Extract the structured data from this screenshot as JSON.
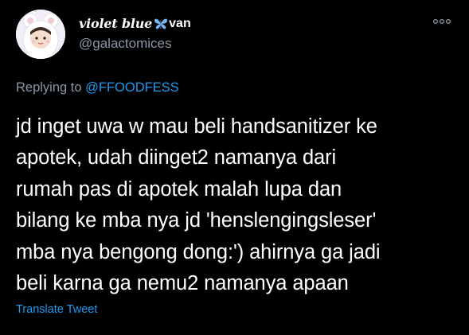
{
  "tweet": {
    "author": {
      "display_name": "violet blue",
      "display_name_suffix": "van",
      "name_emoji": "butterfly-icon",
      "handle": "@galactomices",
      "avatar": "avatar"
    },
    "more_icon": "more-options-icon",
    "reply_context": {
      "prefix": "Replying to ",
      "mention": "@FFOODFESS"
    },
    "text_lines": [
      "jd inget uwa w mau beli handsanitizer ke",
      "apotek, udah diinget2 namanya dari",
      "rumah pas di apotek malah lupa dan",
      "bilang ke mba nya jd 'henslengingsleser'",
      "mba nya bengong dong:') ahirnya ga jadi",
      "beli karna ga nemu2 namanya apaan"
    ],
    "translate_label": "Translate Tweet"
  },
  "colors": {
    "background": "#000000",
    "primary_text": "#ffffff",
    "secondary_text": "#8b98a5",
    "link": "#1d9bf0",
    "butterfly": "#7fb6f2"
  }
}
